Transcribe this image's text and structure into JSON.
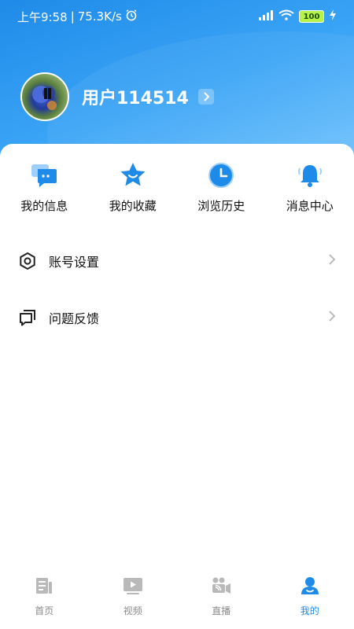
{
  "status_bar": {
    "time": "上午9:58",
    "network_speed": "75.3K/s",
    "battery": "100"
  },
  "profile": {
    "username": "用户114514"
  },
  "quick_actions": [
    {
      "label": "我的信息",
      "icon": "message-icon"
    },
    {
      "label": "我的收藏",
      "icon": "star-icon"
    },
    {
      "label": "浏览历史",
      "icon": "clock-icon"
    },
    {
      "label": "消息中心",
      "icon": "bell-icon"
    }
  ],
  "menu": [
    {
      "label": "账号设置",
      "icon": "settings-icon"
    },
    {
      "label": "问题反馈",
      "icon": "feedback-icon"
    }
  ],
  "tabs": [
    {
      "label": "首页",
      "icon": "home-doc-icon",
      "active": false
    },
    {
      "label": "视频",
      "icon": "video-icon",
      "active": false
    },
    {
      "label": "直播",
      "icon": "live-icon",
      "active": false
    },
    {
      "label": "我的",
      "icon": "user-icon",
      "active": true
    }
  ],
  "colors": {
    "accent": "#1f8be8",
    "header_gradient_start": "#1f8be8",
    "header_gradient_end": "#6cc0fb",
    "inactive_tab": "#b9b9b9"
  }
}
